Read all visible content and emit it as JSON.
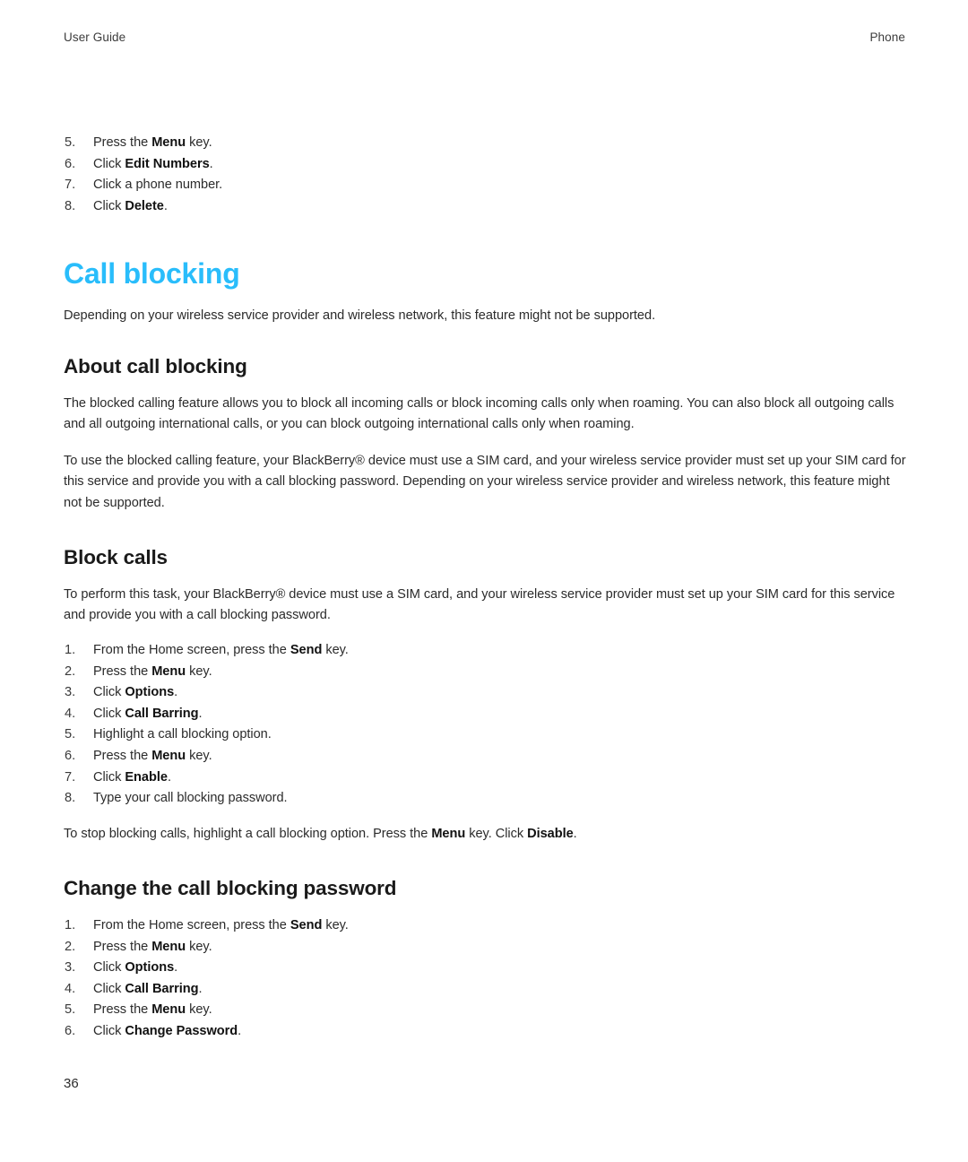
{
  "running_head": {
    "left": "User Guide",
    "right": "Phone"
  },
  "continued_list": {
    "items": [
      {
        "num": "5.",
        "pre": "Press the ",
        "bold": "Menu",
        "post": " key."
      },
      {
        "num": "6.",
        "pre": "Click ",
        "bold": "Edit Numbers",
        "post": "."
      },
      {
        "num": "7.",
        "pre": "Click a phone number.",
        "bold": "",
        "post": ""
      },
      {
        "num": "8.",
        "pre": "Click ",
        "bold": "Delete",
        "post": "."
      }
    ]
  },
  "chapter": {
    "title": "Call blocking",
    "title_color": "#29bdfb",
    "intro": "Depending on your wireless service provider and wireless network, this feature might not be supported."
  },
  "sections": [
    {
      "id": "about-call-blocking",
      "title": "About call blocking",
      "paragraphs": [
        "The blocked calling feature allows you to block all incoming calls or block incoming calls only when roaming. You can also block all outgoing calls and all outgoing international calls, or you can block outgoing international calls only when roaming.",
        "To use the blocked calling feature, your BlackBerry® device must use a SIM card, and your wireless service provider must set up your SIM card for this service and provide you with a call blocking password. Depending on your wireless service provider and wireless network, this feature might not be supported."
      ]
    },
    {
      "id": "block-calls",
      "title": "Block calls",
      "intro": "To perform this task, your BlackBerry® device must use a SIM card, and your wireless service provider must set up your SIM card for this service and provide you with a call blocking password.",
      "steps": [
        {
          "num": "1.",
          "pre": "From the Home screen, press the ",
          "bold": "Send",
          "post": " key."
        },
        {
          "num": "2.",
          "pre": "Press the ",
          "bold": "Menu",
          "post": " key."
        },
        {
          "num": "3.",
          "pre": "Click ",
          "bold": "Options",
          "post": "."
        },
        {
          "num": "4.",
          "pre": "Click ",
          "bold": "Call Barring",
          "post": "."
        },
        {
          "num": "5.",
          "pre": "Highlight a call blocking option.",
          "bold": "",
          "post": ""
        },
        {
          "num": "6.",
          "pre": "Press the ",
          "bold": "Menu",
          "post": " key."
        },
        {
          "num": "7.",
          "pre": "Click ",
          "bold": "Enable",
          "post": "."
        },
        {
          "num": "8.",
          "pre": "Type your call blocking password.",
          "bold": "",
          "post": ""
        }
      ],
      "footnote": {
        "seg1": "To stop blocking calls, highlight a call blocking option. Press the ",
        "bold1": "Menu",
        "seg2": " key. Click ",
        "bold2": "Disable",
        "seg3": "."
      }
    },
    {
      "id": "change-password",
      "title": "Change the call blocking password",
      "steps": [
        {
          "num": "1.",
          "pre": "From the Home screen, press the ",
          "bold": "Send",
          "post": " key."
        },
        {
          "num": "2.",
          "pre": "Press the ",
          "bold": "Menu",
          "post": " key."
        },
        {
          "num": "3.",
          "pre": "Click ",
          "bold": "Options",
          "post": "."
        },
        {
          "num": "4.",
          "pre": "Click ",
          "bold": "Call Barring",
          "post": "."
        },
        {
          "num": "5.",
          "pre": "Press the ",
          "bold": "Menu",
          "post": " key."
        },
        {
          "num": "6.",
          "pre": "Click ",
          "bold": "Change Password",
          "post": "."
        }
      ]
    }
  ],
  "folio": "36"
}
